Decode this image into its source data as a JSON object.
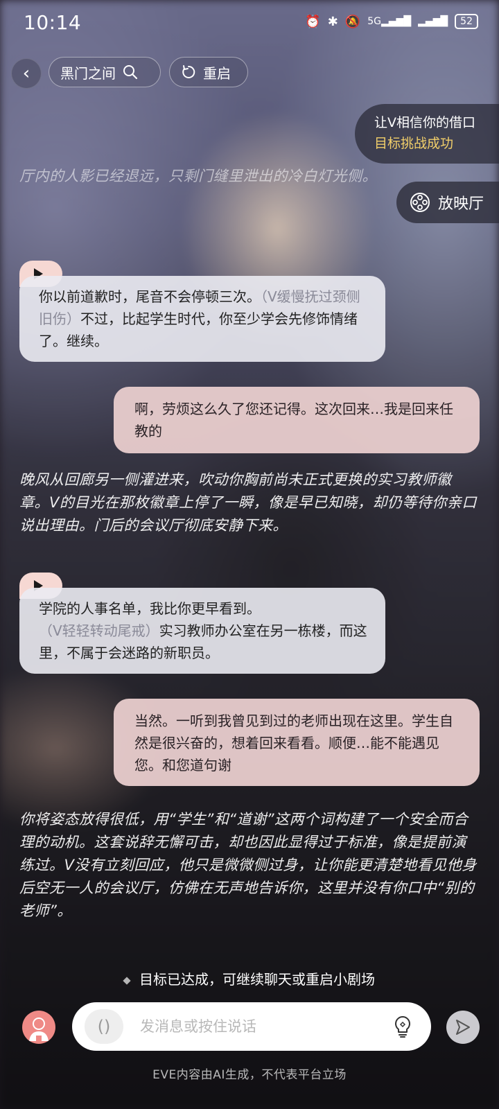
{
  "status_bar": {
    "time": "10:14",
    "network_label": "5G",
    "battery": "52"
  },
  "nav": {
    "scene_title": "黑门之间",
    "restart_label": "重启"
  },
  "goal": {
    "title": "让V相信你的借口",
    "status": "目标挑战成功",
    "status_color": "#f2cf6a"
  },
  "cinema": {
    "label": "放映厅"
  },
  "narrations": {
    "faded": "厅内的人影已经退远，只剩门缝里泄出的冷白灯光侧。",
    "n1": "晚风从回廊另一侧灌进来，吹动你胸前尚未正式更换的实习教师徽章。V的目光在那枚徽章上停了一瞬，像是早已知晓，却仍等待你亲口说出理由。门后的会议厅彻底安静下来。",
    "n2": "你将姿态放得很低，用“学生”和“道谢”这两个词构建了一个安全而合理的动机。这套说辞无懈可击，却也因此显得过于标准，像是提前演练过。V没有立刻回应，他只是微微侧过身，让你能更清楚地看见他身后空无一人的会议厅，仿佛在无声地告诉你，这里并没有你口中“别的老师”。"
  },
  "messages": {
    "ai1": {
      "text_a": "你以前道歉时，尾音不会停顿三次。",
      "action": "（V缓慢抚过颈侧旧伤）",
      "text_b": "不过，比起学生时代，你至少学会先修饰情绪了。继续。"
    },
    "user1": {
      "text": "啊，劳烦这么久了您还记得。这次回来…我是回来任教的"
    },
    "ai2": {
      "text_a": "学院的人事名单，我比你更早看到。",
      "action": "（V轻轻转动尾戒）",
      "text_b": "实习教师办公室在另一栋楼，而这里，不属于会迷路的新职员。"
    },
    "user2": {
      "text": "当然。一听到我曾见到过的老师出现在这里。学生自然是很兴奋的，想着回来看看。顺便…能不能遇见您。和您道句谢"
    }
  },
  "goal_hint": "目标已达成，可继续聊天或重启小剧场",
  "input": {
    "placeholder": "发消息或按住说话",
    "voice_icon": "()"
  },
  "disclaimer": "EVE内容由AI生成，不代表平台立场"
}
